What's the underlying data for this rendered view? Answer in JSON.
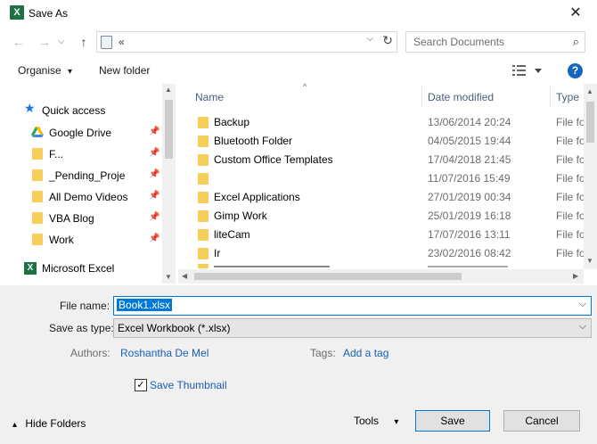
{
  "window": {
    "title": "Save As",
    "close_glyph": "✕",
    "app_icon": "excel-icon",
    "app_icon_letter": "X"
  },
  "address": {
    "back": "←",
    "forward": "→",
    "up": "↑",
    "path": "«",
    "refresh": "↻",
    "dropdown": "⌵"
  },
  "search": {
    "placeholder": "Search Documents",
    "icon": "⌕"
  },
  "toolbar": {
    "organise": "Organise",
    "new_folder": "New folder",
    "help": "?",
    "dropdown": "▾"
  },
  "nav": {
    "quick_access": "Quick access",
    "items": [
      {
        "label": "Google Drive",
        "icon": "google-drive-icon",
        "pinned": true
      },
      {
        "label": "F...",
        "icon": "folder-icon",
        "pinned": true
      },
      {
        "label": "_Pending_Proje",
        "icon": "folder-icon",
        "pinned": true
      },
      {
        "label": "All Demo Videos",
        "icon": "folder-icon",
        "pinned": true
      },
      {
        "label": "VBA Blog",
        "icon": "folder-icon",
        "pinned": true
      },
      {
        "label": "Work",
        "icon": "folder-icon",
        "pinned": true
      }
    ],
    "microsoft_excel": "Microsoft Excel",
    "pin_glyph": "📌"
  },
  "columns": {
    "name": "Name",
    "date": "Date modified",
    "type": "Type"
  },
  "files": [
    {
      "name": "Backup",
      "date": "13/06/2014 20:24",
      "type": "File fo"
    },
    {
      "name": "Bluetooth Folder",
      "date": "04/05/2015 19:44",
      "type": "File fo"
    },
    {
      "name": "Custom Office Templates",
      "date": "17/04/2018 21:45",
      "type": "File fo"
    },
    {
      "name": "",
      "date": "11/07/2016 15:49",
      "type": "File fo"
    },
    {
      "name": "Excel Applications",
      "date": "27/01/2019 00:34",
      "type": "File fo"
    },
    {
      "name": "Gimp Work",
      "date": "25/01/2019 16:18",
      "type": "File fo"
    },
    {
      "name": "liteCam",
      "date": "17/07/2016 13:11",
      "type": "File fo"
    },
    {
      "name": "Ir",
      "date": "23/02/2016 08:42",
      "type": "File fo"
    }
  ],
  "form": {
    "file_name_label": "File name:",
    "file_name_value": "Book1.xlsx",
    "save_type_label": "Save as type:",
    "save_type_value": "Excel Workbook (*.xlsx)",
    "authors_label": "Authors:",
    "authors_value": "Roshantha De Mel",
    "tags_label": "Tags:",
    "tags_value": "Add a tag",
    "save_thumbnail_label": "Save Thumbnail",
    "save_thumbnail_checked": true,
    "check_glyph": "✓"
  },
  "footer": {
    "hide_folders": "Hide Folders",
    "hide_glyph": "▴",
    "tools": "Tools",
    "save": "Save",
    "cancel": "Cancel"
  }
}
